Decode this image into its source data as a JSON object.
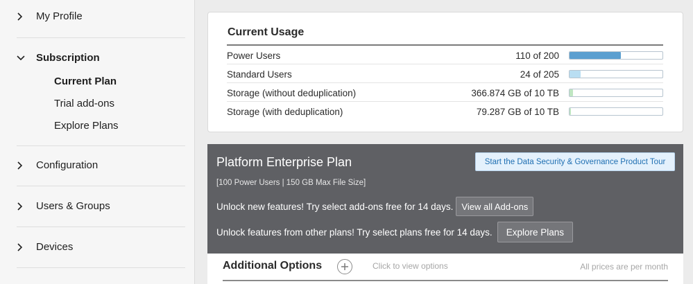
{
  "sidebar": {
    "my_profile": "My Profile",
    "subscription": "Subscription",
    "sub_items": {
      "current_plan": "Current Plan",
      "trial_addons": "Trial add-ons",
      "explore_plans": "Explore Plans"
    },
    "configuration": "Configuration",
    "users_groups": "Users & Groups",
    "devices": "Devices"
  },
  "usage": {
    "title": "Current Usage",
    "rows": [
      {
        "name": "Power Users",
        "value": "110 of 200",
        "fraction": 0.55,
        "color": "#5b9fd0"
      },
      {
        "name": "Standard Users",
        "value": "24 of 205",
        "fraction": 0.117,
        "color": "#b9def2"
      },
      {
        "name": "Storage (without deduplication)",
        "value": "366.874 GB of 10 TB",
        "fraction": 0.036,
        "color": "#bfe6c2"
      },
      {
        "name": "Storage (with deduplication)",
        "value": "79.287 GB of 10 TB",
        "fraction": 0.008,
        "color": "#bfe6c2"
      }
    ]
  },
  "plan": {
    "title": "Platform Enterprise Plan",
    "tour_button": "Start the Data Security & Governance Product Tour",
    "meta": "[100 Power Users | 150 GB Max File Size]",
    "unlock_addons_text": "Unlock new features! Try select add-ons free for 14 days.",
    "view_addons_button": "View all Add-ons",
    "unlock_plans_text": "Unlock features from other plans! Try select plans free for 14 days.",
    "explore_plans_button": "Explore Plans"
  },
  "additional": {
    "title": "Additional Options",
    "hint": "Click to view options",
    "note": "All prices are per month"
  }
}
